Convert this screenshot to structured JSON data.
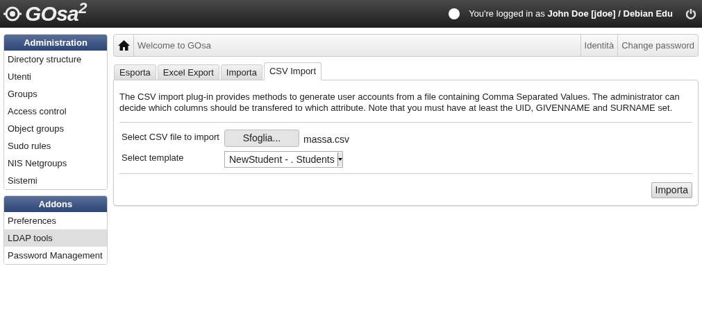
{
  "header": {
    "logo": "**GO**sa$^{2}$",
    "login_text": "You're logged in as **John Doe [jdoe] / Debian Edu**"
  },
  "sidebar": [
    {
      "title": "Administration",
      "items": [
        {
          "label": "Directory structure",
          "selected": false
        },
        {
          "label": "Utenti",
          "selected": false
        },
        {
          "label": "Groups",
          "selected": false
        },
        {
          "label": "Access control",
          "selected": false
        },
        {
          "label": "Object groups",
          "selected": false
        },
        {
          "label": "Sudo rules",
          "selected": false
        },
        {
          "label": "NIS Netgroups",
          "selected": false
        },
        {
          "label": "Sistemi",
          "selected": false
        }
      ]
    },
    {
      "title": "Addons",
      "items": [
        {
          "label": "Preferences",
          "selected": false
        },
        {
          "label": "LDAP tools",
          "selected": true
        },
        {
          "label": "Password Management",
          "selected": false
        }
      ]
    }
  ],
  "breadcrumb": {
    "title": "Welcome to GOsa",
    "links": [
      "Identità",
      "Change password"
    ]
  },
  "tabs": [
    {
      "label": "Esporta",
      "selected": false
    },
    {
      "label": "Excel Export",
      "selected": false
    },
    {
      "label": "Importa",
      "selected": false
    },
    {
      "label": "CSV Import",
      "selected": true
    }
  ],
  "description": "The CSV import plug-in provides methods to generate user accounts from a file containing Comma Separated Values. The administrator can decide which columns should be transfered to which attribute. Note that you must have at least the UID, GIVENNAME and SURNAME set.",
  "form": {
    "file_label": "Select CSV file to import",
    "browse_button": "Sfoglia...",
    "file_name": "massa.csv",
    "template_label": "Select template",
    "template_value": "NewStudent - . Students"
  },
  "submit_button": "Importa"
}
